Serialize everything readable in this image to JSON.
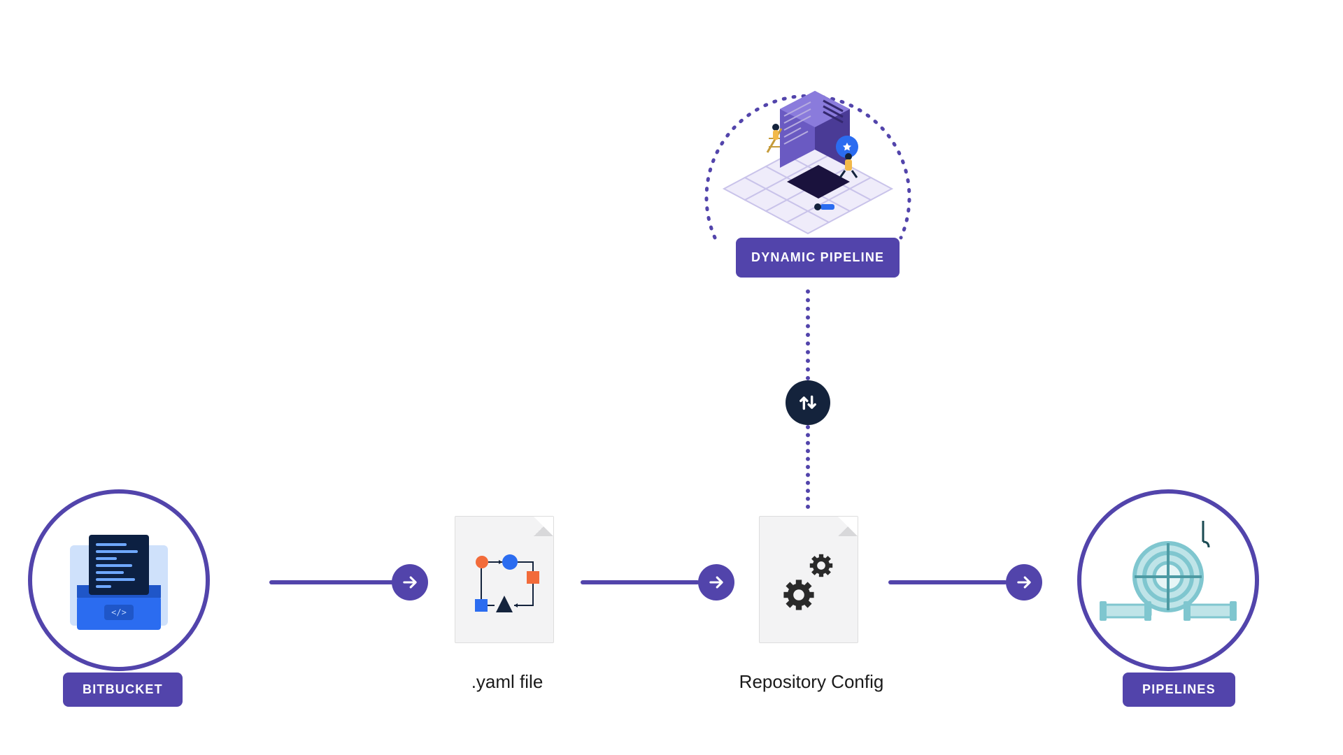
{
  "nodes": {
    "bitbucket": {
      "label": "BITBUCKET"
    },
    "yaml": {
      "label": ".yaml file"
    },
    "repo_config": {
      "label": "Repository Config"
    },
    "pipelines": {
      "label": "PIPELINES"
    },
    "dynamic_pipeline": {
      "label": "DYNAMIC PIPELINE"
    }
  },
  "colors": {
    "primary": "#5244ab",
    "dark": "#14233c",
    "orange": "#f26b3a",
    "blue": "#2b6cf0",
    "teal": "#9ed7dd"
  },
  "diagram": {
    "flow": [
      "bitbucket",
      "yaml",
      "repo_config",
      "pipelines"
    ],
    "bidirectional": [
      "dynamic_pipeline",
      "repo_config"
    ]
  }
}
